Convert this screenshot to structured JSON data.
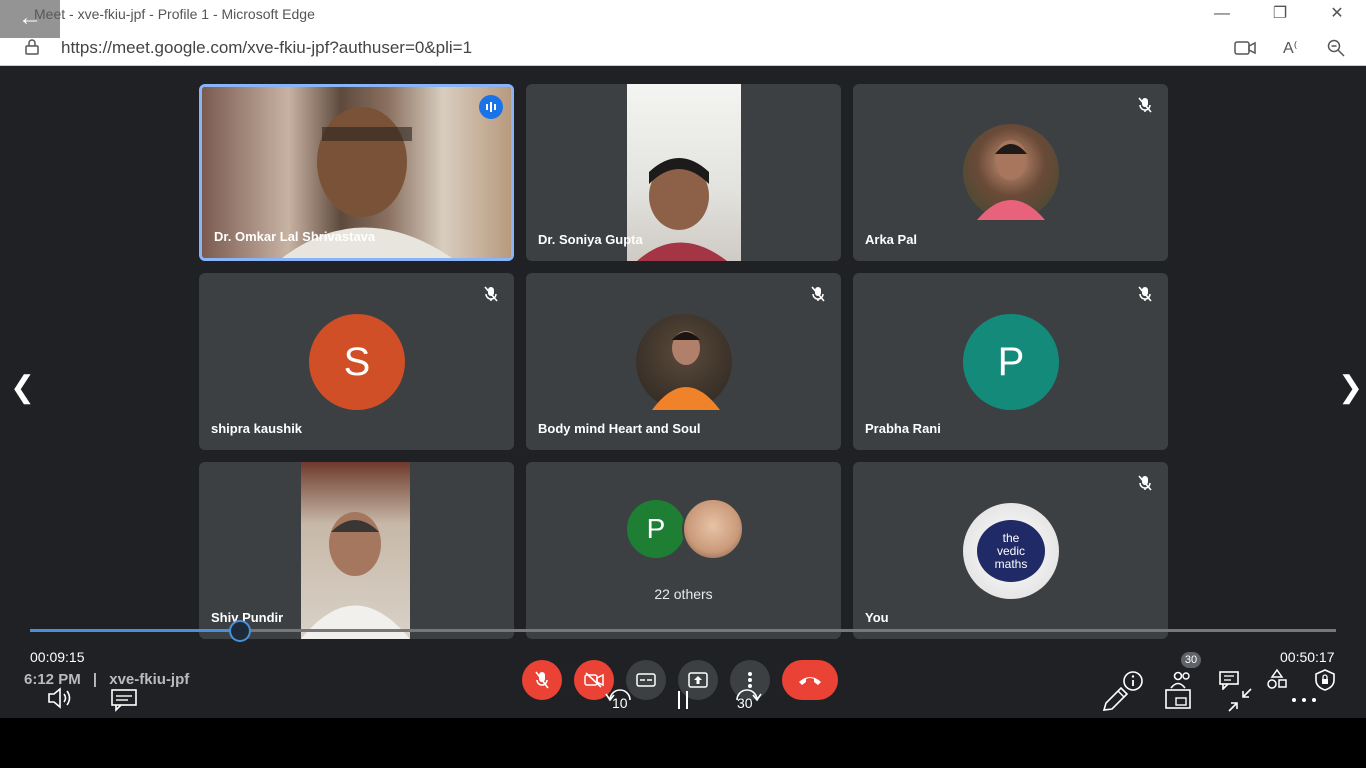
{
  "window": {
    "title": "Meet - xve-fkiu-jpf - Profile 1 - Microsoft Edge",
    "url": "https://meet.google.com/xve-fkiu-jpf?authuser=0&pli=1"
  },
  "participants": [
    {
      "name": "Dr. Omkar Lal Shrivastava",
      "state": "speaking-video"
    },
    {
      "name": "Dr. Soniya Gupta",
      "state": "video"
    },
    {
      "name": "Arka Pal",
      "state": "photo-avatar",
      "muted": true
    },
    {
      "name": "shipra kaushik",
      "state": "letter-avatar",
      "letter": "S",
      "color": "#d04f27",
      "muted": true
    },
    {
      "name": "Body mind Heart and Soul",
      "state": "photo-avatar",
      "muted": true
    },
    {
      "name": "Prabha Rani",
      "state": "letter-avatar",
      "letter": "P",
      "color": "#148a7a",
      "muted": true
    },
    {
      "name": "Shiv Pundir",
      "state": "video"
    },
    {
      "name": "",
      "state": "others",
      "letter": "P",
      "color": "#1e7e34",
      "others_label": "22 others"
    },
    {
      "name": "You",
      "state": "logo-avatar",
      "logo_text": [
        "the",
        "vedic",
        "maths"
      ],
      "muted": true
    }
  ],
  "player": {
    "elapsed": "00:09:15",
    "total": "00:50:17",
    "progress": 0.161,
    "rewind_label": "10",
    "forward_label": "30"
  },
  "meeting": {
    "time": "6:12 PM",
    "separator": "|",
    "code": "xve-fkiu-jpf",
    "participant_count": "30"
  },
  "colors": {
    "accent": "#1a73e8",
    "danger": "#ea4335",
    "tile_bg": "#3c4043",
    "stage_bg": "#202124"
  }
}
